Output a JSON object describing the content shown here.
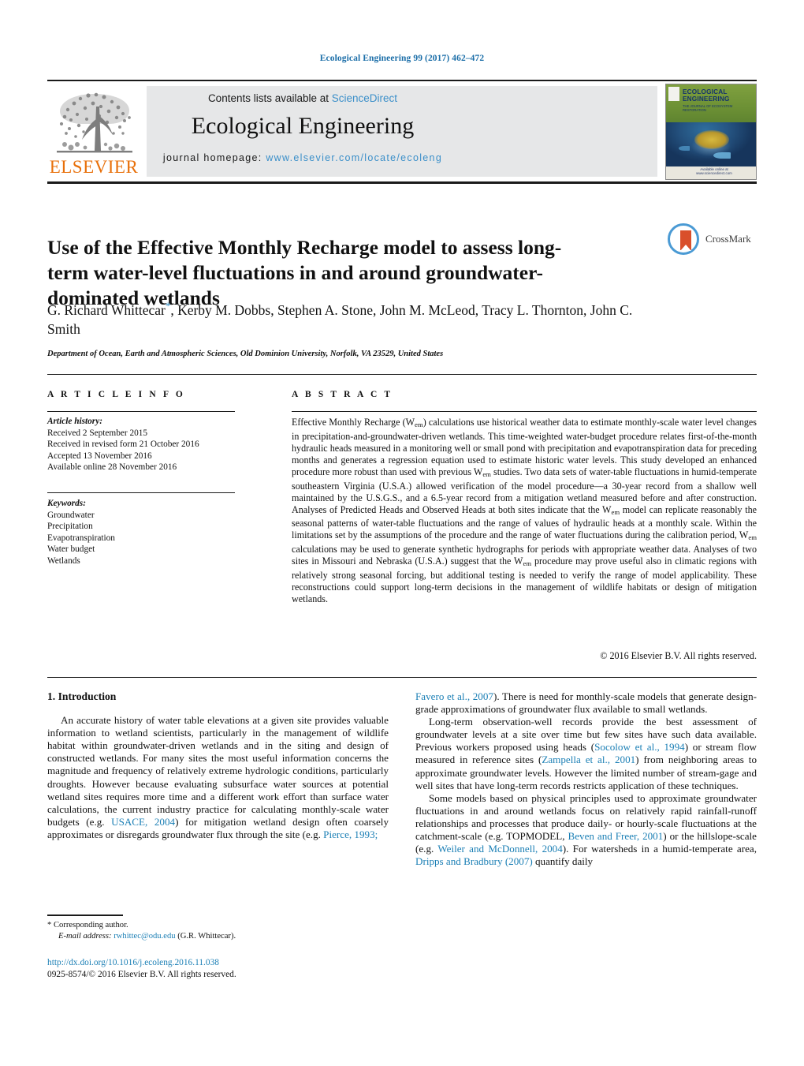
{
  "running_head": "Ecological Engineering 99 (2017) 462–472",
  "masthead": {
    "contents_prefix": "Contents lists available at ",
    "sciencedirect": "ScienceDirect",
    "journal_title": "Ecological Engineering",
    "homepage_label": "journal homepage: ",
    "homepage_url": "www.elsevier.com/locate/ecoleng",
    "publisher_logo_text": "ELSEVIER",
    "cover": {
      "journal_name": "ECOLOGICAL ENGINEERING",
      "subtitle": "THE JOURNAL OF ECOSYSTEM RESTORATION",
      "footer": "Available online at www.sciencedirect.com"
    }
  },
  "article": {
    "title": "Use of the Effective Monthly Recharge model to assess long-term water-level fluctuations in and around groundwater-dominated wetlands",
    "authors": "G. Richard Whittecar, Kerby M. Dobbs, Stephen A. Stone, John M. McLeod, Tracy L. Thornton, John C. Smith",
    "author_marker": "*",
    "affiliation": "Department of Ocean, Earth and Atmospheric Sciences, Old Dominion University, Norfolk, VA 23529, United States",
    "crossmark_label": "CrossMark"
  },
  "article_info": {
    "heading": "A R T I C L E   I N F O",
    "history_label": "Article history:",
    "history": [
      "Received 2 September 2015",
      "Received in revised form 21 October 2016",
      "Accepted 13 November 2016",
      "Available online 28 November 2016"
    ],
    "keywords_label": "Keywords:",
    "keywords": [
      "Groundwater",
      "Precipitation",
      "Evapotranspiration",
      "Water budget",
      "Wetlands"
    ]
  },
  "abstract": {
    "heading": "A B S T R A C T",
    "part1": "Effective Monthly Recharge (W",
    "sub1": "em",
    "part2": ") calculations use historical weather data to estimate monthly-scale water level changes in precipitation-and-groundwater-driven wetlands. This time-weighted water-budget procedure relates first-of-the-month hydraulic heads measured in a monitoring well or small pond with precipitation and evapotranspiration data for preceding months and generates a regression equation used to estimate historic water levels. This study developed an enhanced procedure more robust than used with previous W",
    "sub2": "em",
    "part3": " studies. Two data sets of water-table fluctuations in humid-temperate southeastern Virginia (U.S.A.) allowed verification of the model procedure—a 30-year record from a shallow well maintained by the U.S.G.S., and a 6.5-year record from a mitigation wetland measured before and after construction. Analyses of Predicted Heads and Observed Heads at both sites indicate that the W",
    "sub3": "em",
    "part4": " model can replicate reasonably the seasonal patterns of water-table fluctuations and the range of values of hydraulic heads at a monthly scale. Within the limitations set by the assumptions of the procedure and the range of water fluctuations during the calibration period, W",
    "sub4": "em",
    "part5": " calculations may be used to generate synthetic hydrographs for periods with appropriate weather data. Analyses of two sites in Missouri and Nebraska (U.S.A.) suggest that the W",
    "sub5": "em",
    "part6": " procedure may prove useful also in climatic regions with relatively strong seasonal forcing, but additional testing is needed to verify the range of model applicability. These reconstructions could support long-term decisions in the management of wildlife habitats or design of mitigation wetlands.",
    "copyright": "© 2016 Elsevier B.V. All rights reserved."
  },
  "introduction": {
    "heading": "1.  Introduction",
    "left_p1_a": "An accurate history of water table elevations at a given site provides valuable information to wetland scientists, particularly in the management of wildlife habitat within groundwater-driven wetlands and in the siting and design of constructed wetlands. For many sites the most useful information concerns the magnitude and frequency of relatively extreme hydrologic conditions, particularly droughts. However because evaluating subsurface water sources at potential wetland sites requires more time and a different work effort than surface water calculations, the current industry practice for calculating monthly-scale water budgets (e.g. ",
    "left_ref1": "USACE, 2004",
    "left_p1_b": ") for mitigation wetland design often coarsely approximates or disregards groundwater flux through the site (e.g. ",
    "left_ref2": "Pierce, 1993;",
    "right_ref1": "Favero et al., 2007",
    "right_p1_a": "). There is need for monthly-scale models that generate design-grade approximations of groundwater flux available to small wetlands.",
    "right_p2_a": "Long-term observation-well records provide the best assessment of groundwater levels at a site over time but few sites have such data available. Previous workers proposed using heads (",
    "right_ref2": "Socolow et al., 1994",
    "right_p2_b": ") or stream flow measured in reference sites (",
    "right_ref3": "Zampella et al., 2001",
    "right_p2_c": ") from neighboring areas to approximate groundwater levels. However the limited number of stream-gage and well sites that have long-term records restricts application of these techniques.",
    "right_p3_a": "Some models based on physical principles used to approximate groundwater fluctuations in and around wetlands focus on relatively rapid rainfall-runoff relationships and processes that produce daily- or hourly-scale fluctuations at the catchment-scale (e.g. TOPMODEL, ",
    "right_ref4": "Beven and Freer, 2001",
    "right_p3_b": ") or the hillslope-scale (e.g. ",
    "right_ref5": "Weiler and McDonnell, 2004",
    "right_p3_c": "). For watersheds in a humid-temperate area, ",
    "right_ref6": "Dripps and Bradbury (2007)",
    "right_p3_d": " quantify daily"
  },
  "footnote": {
    "marker": "*",
    "corresponding": " Corresponding author.",
    "email_label": "E-mail address:",
    "email": "rwhittec@odu.edu",
    "email_owner": "(G.R. Whittecar)."
  },
  "footer": {
    "doi": "http://dx.doi.org/10.1016/j.ecoleng.2016.11.038",
    "issn_line": "0925-8574/© 2016 Elsevier B.V. All rights reserved."
  }
}
